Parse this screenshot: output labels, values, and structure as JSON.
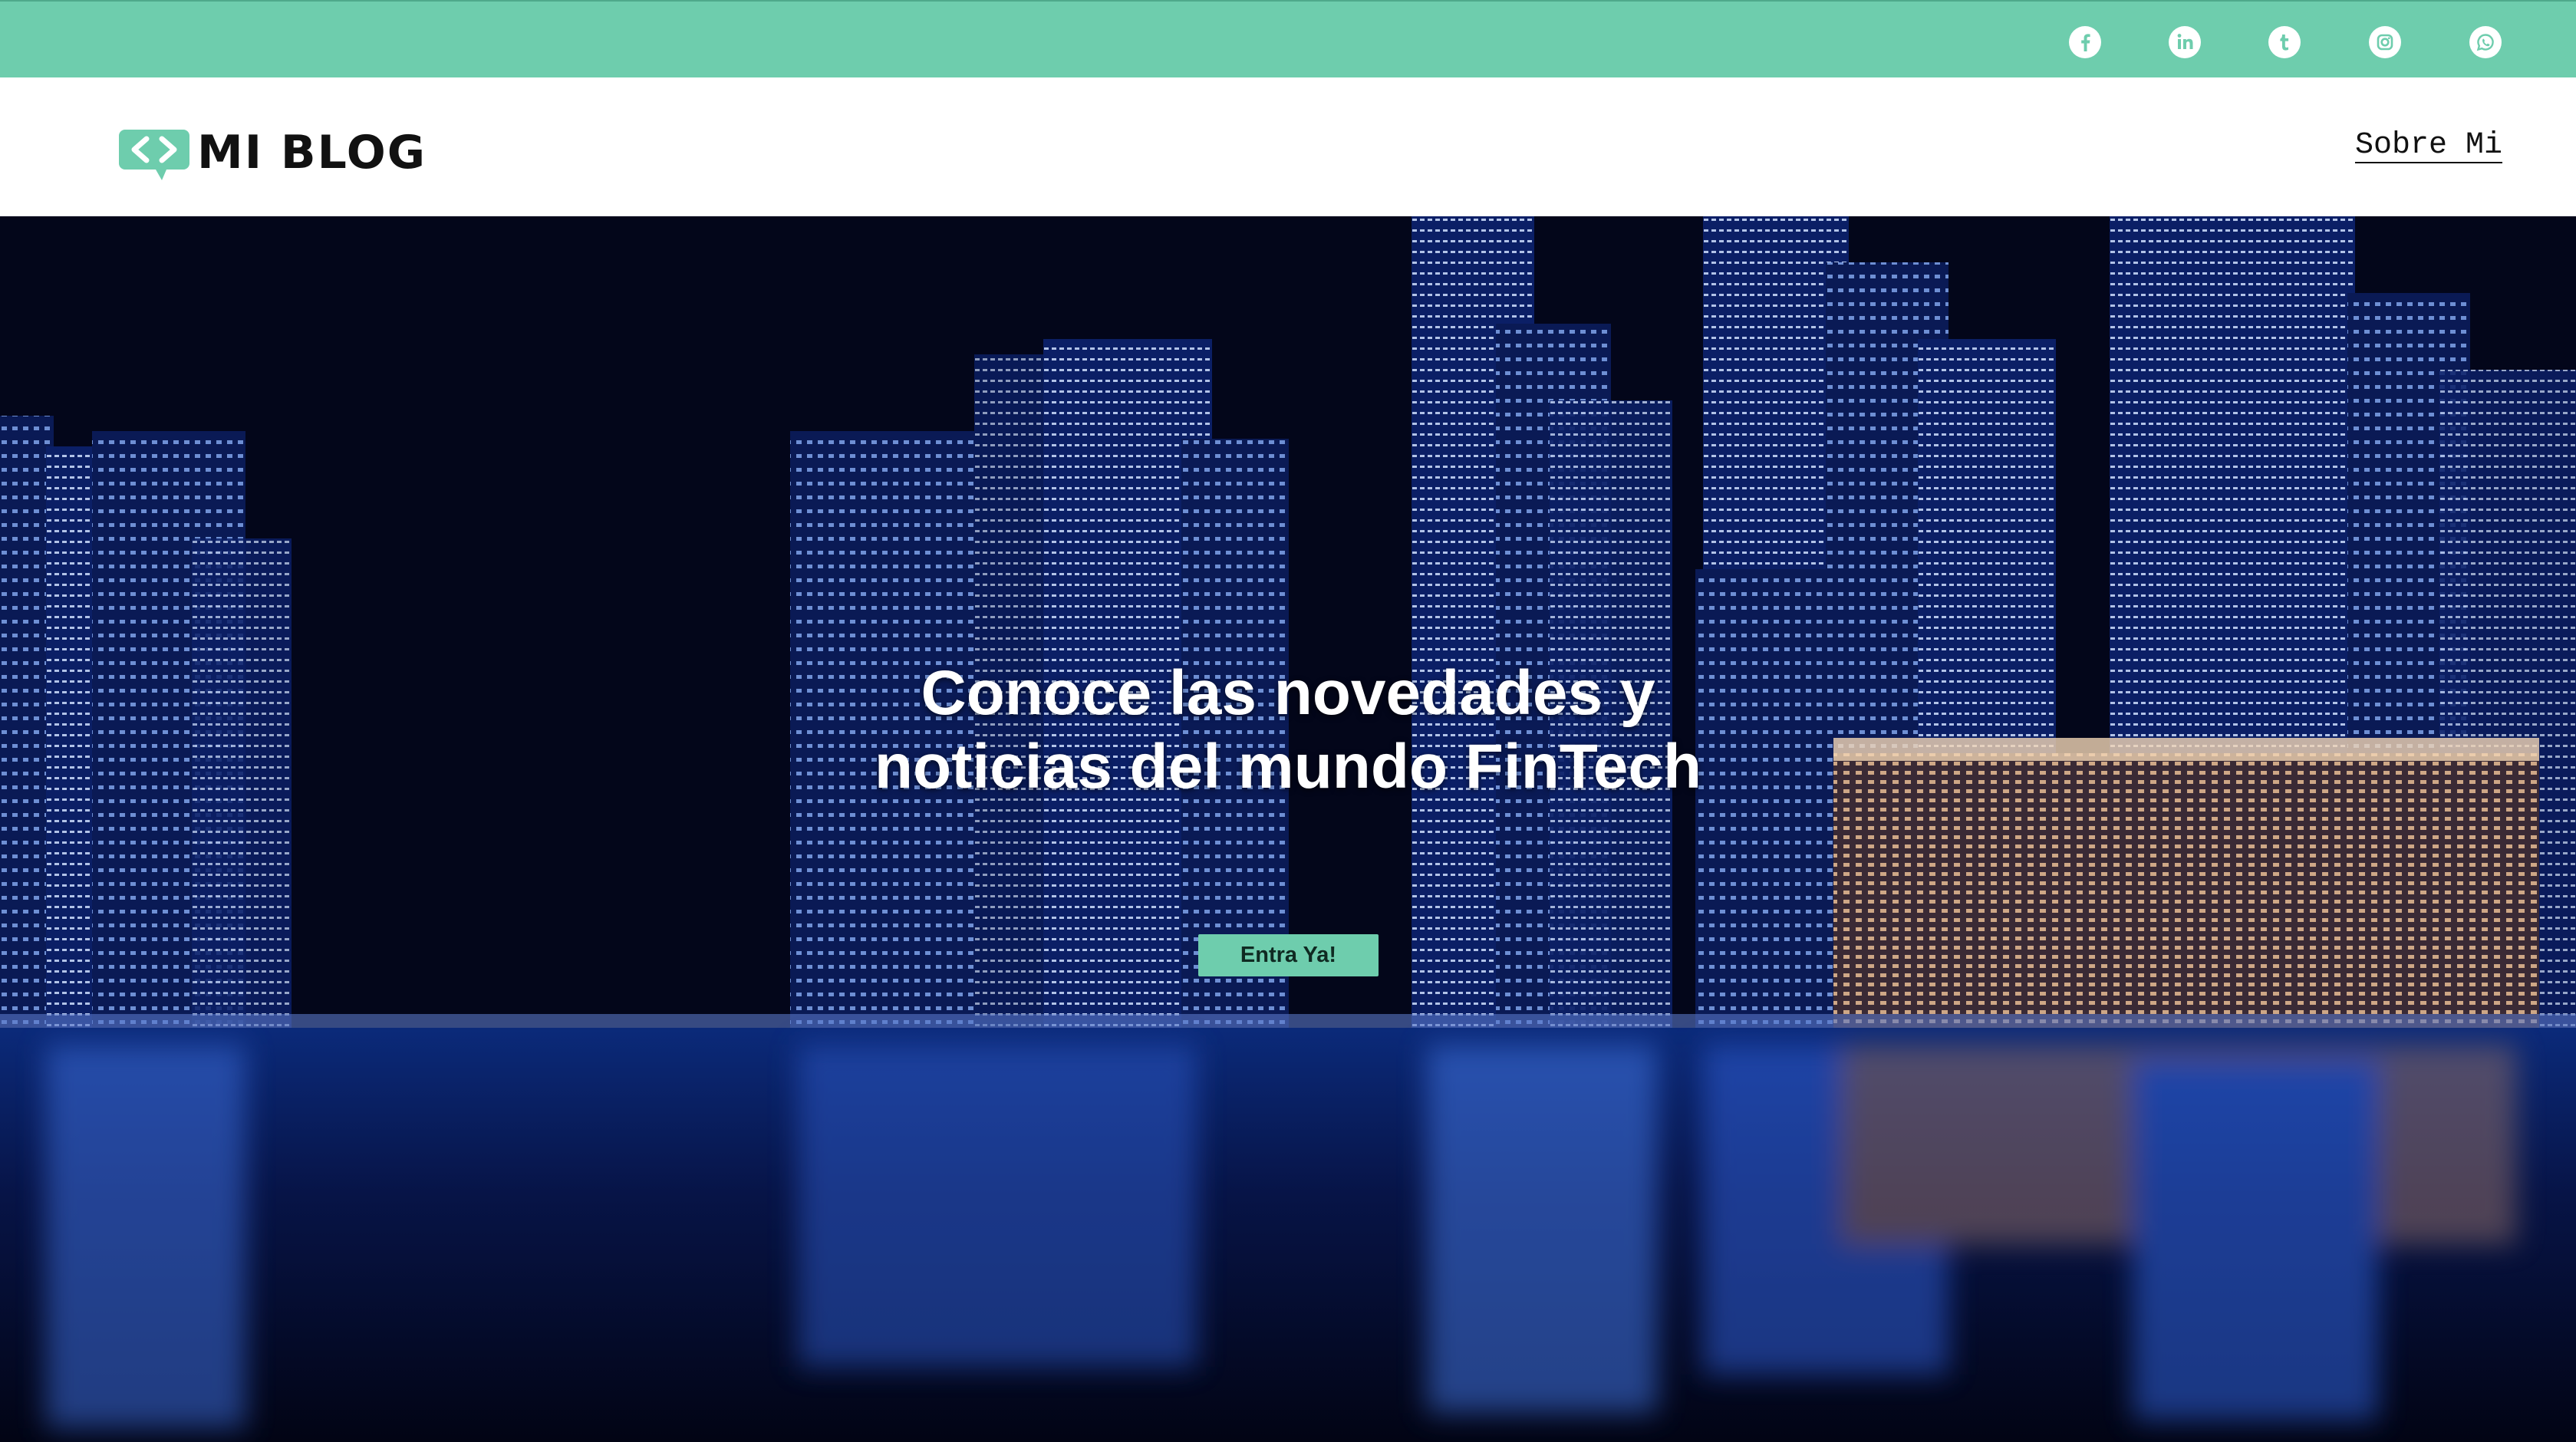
{
  "colors": {
    "accent": "#6ecdad",
    "header_bg": "#ffffff",
    "text_dark": "#111111",
    "hero_text": "#ffffff"
  },
  "top_bar": {
    "social_links": [
      {
        "name": "facebook",
        "icon": "facebook-icon"
      },
      {
        "name": "linkedin",
        "icon": "linkedin-icon"
      },
      {
        "name": "tumblr",
        "icon": "tumblr-icon"
      },
      {
        "name": "instagram",
        "icon": "instagram-icon"
      },
      {
        "name": "whatsapp",
        "icon": "whatsapp-icon"
      }
    ]
  },
  "header": {
    "logo_text": "MI BLOG",
    "nav": {
      "about_label": "Sobre Mi"
    }
  },
  "hero": {
    "title": "Conoce las novedades y noticias del mundo FinTech",
    "button_label": "Entra Ya!"
  }
}
